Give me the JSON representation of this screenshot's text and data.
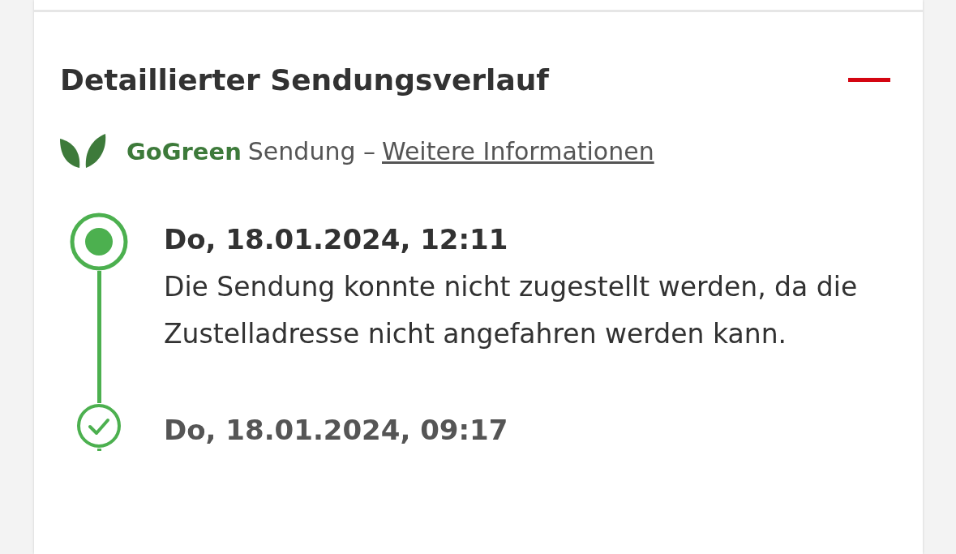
{
  "section": {
    "title": "Detaillierter Sendungsverlauf",
    "expanded": true
  },
  "gogreen": {
    "brand": "GoGreen",
    "text": "Sendung –",
    "link": "Weitere Informationen"
  },
  "events": [
    {
      "kind": "current",
      "date": "Do, 18.01.2024, 12:11",
      "text": "Die Sendung konnte nicht zugestellt werden, da die Zustelladresse nicht angefahren werden kann."
    },
    {
      "kind": "done",
      "date": "Do, 18.01.2024, 09:17"
    }
  ]
}
